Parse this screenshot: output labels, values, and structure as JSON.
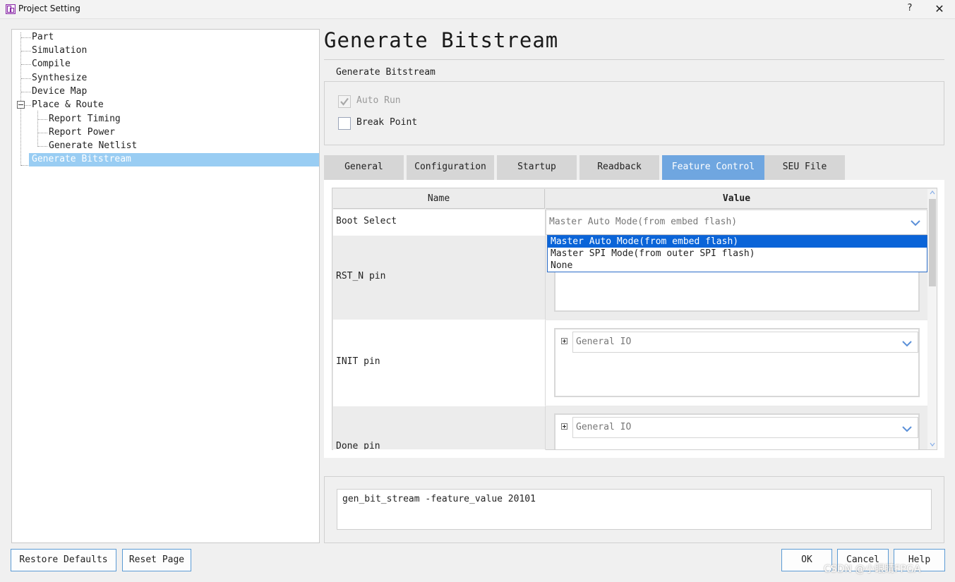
{
  "window": {
    "title": "Project Setting",
    "help": "?",
    "close": "✕"
  },
  "tree": {
    "items": [
      {
        "label": "Part"
      },
      {
        "label": "Simulation"
      },
      {
        "label": "Compile"
      },
      {
        "label": "Synthesize"
      },
      {
        "label": "Device Map"
      },
      {
        "label": "Place & Route"
      },
      {
        "label": "Report Timing"
      },
      {
        "label": "Report Power"
      },
      {
        "label": "Generate Netlist"
      },
      {
        "label": "Generate Bitstream"
      }
    ]
  },
  "page": {
    "title": "Generate Bitstream",
    "section": "Generate Bitstream",
    "options": {
      "auto_run": {
        "label": "Auto Run",
        "checked": true,
        "enabled": false
      },
      "break_point": {
        "label": "Break Point",
        "checked": false
      }
    }
  },
  "tabs": [
    {
      "label": "General"
    },
    {
      "label": "Configuration"
    },
    {
      "label": "Startup"
    },
    {
      "label": "Readback"
    },
    {
      "label": "Feature Control",
      "active": true
    },
    {
      "label": "SEU File"
    }
  ],
  "table": {
    "headers": {
      "name": "Name",
      "value": "Value"
    },
    "rows": [
      {
        "name": "Boot Select",
        "value": "Master Auto Mode(from embed flash)"
      },
      {
        "name": "RST_N pin",
        "value": ""
      },
      {
        "name": "INIT pin",
        "value": "General IO"
      },
      {
        "name": "Done pin",
        "value": "General IO"
      }
    ],
    "dropdown_options": [
      "Master Auto Mode(from embed flash)",
      "Master SPI Mode(from outer SPI flash)",
      "None"
    ]
  },
  "command": "gen_bit_stream -feature_value 20101",
  "buttons": {
    "restore_defaults": "Restore Defaults",
    "reset_page": "Reset Page",
    "ok": "OK",
    "cancel": "Cancel",
    "help": "Help"
  },
  "watermark": "CSDN @小眼睛FPGA",
  "colors": {
    "accent": "#0a64d8",
    "tab_active": "#6fa6e0",
    "tree_selected": "#99cdf3"
  }
}
